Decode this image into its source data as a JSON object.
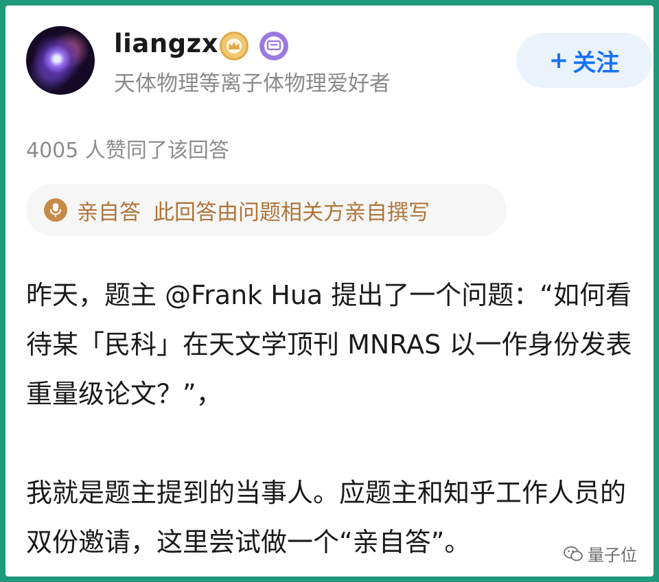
{
  "author": {
    "username": "liangzx",
    "bio": "天体物理等离子体物理爱好者",
    "avatar_icon": "nebula-avatar",
    "badges": [
      "crown-badge-icon",
      "edu-badge-icon"
    ]
  },
  "follow_button": {
    "plus": "+",
    "label": "关注"
  },
  "likes_text": "4005 人赞同了该回答",
  "self_answer": {
    "icon": "mic-icon",
    "tag": "亲自答",
    "description": "此回答由问题相关方亲自撰写"
  },
  "content": {
    "paragraph1": "昨天，题主 @Frank Hua 提出了一个问题：“如何看待某「民科」在天文学顶刊 MNRAS 以一作身份发表重量级论文？”，",
    "paragraph2": "我就是题主提到的当事人。应题主和知乎工作人员的双份邀请，这里尝试做一个“亲自答”。"
  },
  "watermark": "量子位",
  "colors": {
    "frame": "#1e9a78",
    "accent": "#1772f6",
    "self_answer_text": "#b07539",
    "muted": "#8c8c8c"
  }
}
